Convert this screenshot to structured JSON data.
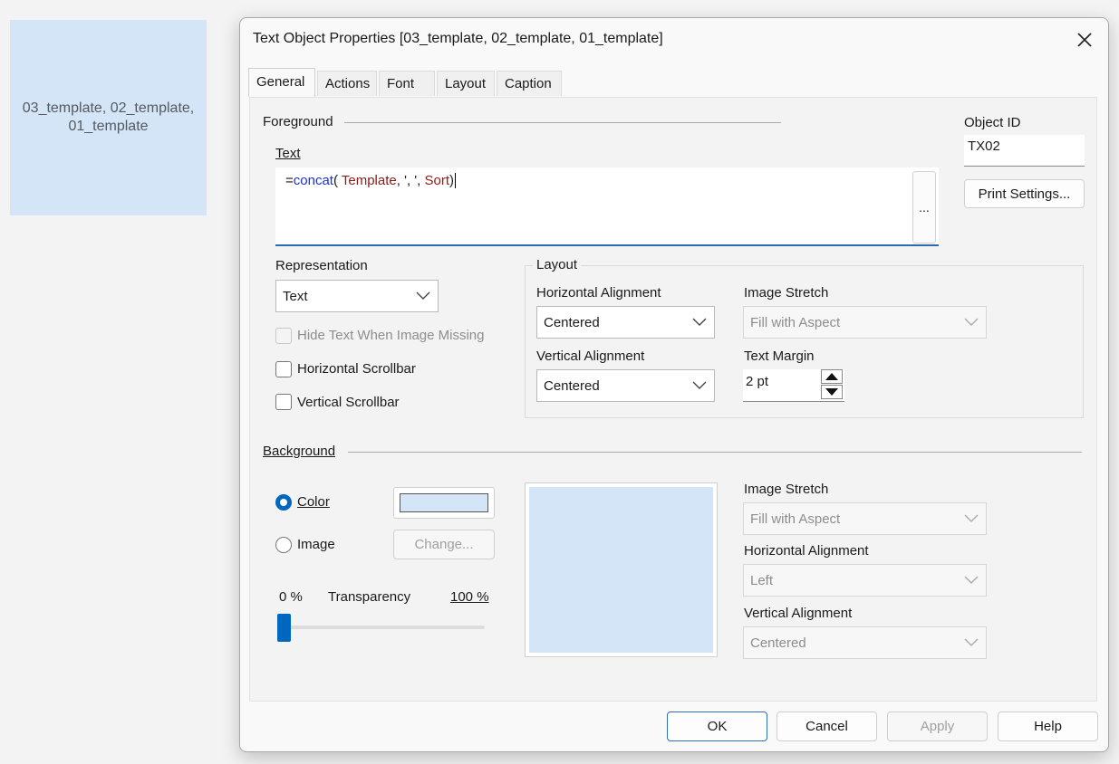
{
  "canvas_object": {
    "label_line1": "03_template, 02_template,",
    "label_line2": "01_template",
    "bg_color": "#d4e5f7"
  },
  "dialog": {
    "title": "Text Object Properties [03_template, 02_template, 01_template]",
    "tabs": [
      {
        "label": "General",
        "active": true
      },
      {
        "label": "Actions",
        "active": false
      },
      {
        "label": "Font",
        "active": false
      },
      {
        "label": "Layout",
        "active": false
      },
      {
        "label": "Caption",
        "active": false
      }
    ],
    "foreground": {
      "group_label": "Foreground",
      "text_label": "Text",
      "expression": {
        "prefix": "=",
        "func": "concat",
        "open": "( ",
        "arg1": "Template",
        "sep": ", ', ', ",
        "arg2": "Sort",
        "close": ")"
      },
      "ellipsis_label": "..."
    },
    "object_id": {
      "label": "Object ID",
      "value": "TX02"
    },
    "print_settings_label": "Print Settings...",
    "representation": {
      "label": "Representation",
      "value": "Text"
    },
    "checkboxes": {
      "hide_text": "Hide Text When Image Missing",
      "horizontal_scrollbar": "Horizontal Scrollbar",
      "vertical_scrollbar": "Vertical Scrollbar"
    },
    "layout_group": {
      "label": "Layout",
      "horizontal_alignment_label": "Horizontal Alignment",
      "horizontal_alignment_value": "Centered",
      "vertical_alignment_label": "Vertical Alignment",
      "vertical_alignment_value": "Centered",
      "image_stretch_label": "Image Stretch",
      "image_stretch_value": "Fill with Aspect",
      "text_margin_label": "Text Margin",
      "text_margin_value": "2 pt"
    },
    "background": {
      "group_label": "Background",
      "color_label": "Color",
      "image_label": "Image",
      "change_label": "Change...",
      "transparency_min": "0 %",
      "transparency_label": "Transparency",
      "transparency_max": "100 %",
      "transparency_value": 0,
      "swatch_color": "#d4e5f7",
      "image_stretch_label": "Image Stretch",
      "image_stretch_value": "Fill with Aspect",
      "horizontal_alignment_label": "Horizontal Alignment",
      "horizontal_alignment_value": "Left",
      "vertical_alignment_label": "Vertical Alignment",
      "vertical_alignment_value": "Centered"
    },
    "buttons": {
      "ok": "OK",
      "cancel": "Cancel",
      "apply": "Apply",
      "help": "Help"
    }
  }
}
